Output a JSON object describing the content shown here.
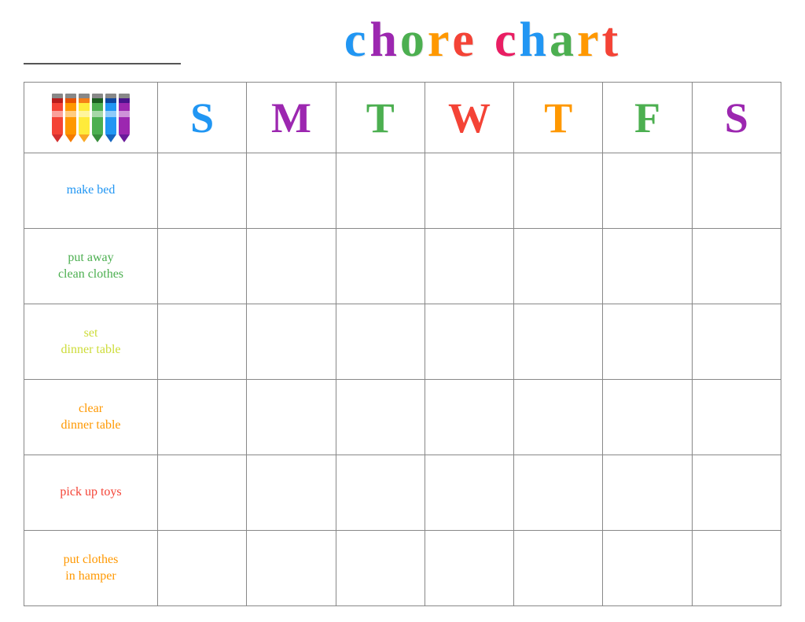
{
  "header": {
    "title_word1": "chore",
    "title_word2": "chart",
    "name_placeholder": ""
  },
  "title_letters": {
    "word1": [
      {
        "char": "c",
        "color": "#2196F3"
      },
      {
        "char": "h",
        "color": "#9C27B0"
      },
      {
        "char": "o",
        "color": "#4CAF50"
      },
      {
        "char": "r",
        "color": "#FF9800"
      },
      {
        "char": "e",
        "color": "#F44336"
      }
    ],
    "word2": [
      {
        "char": "c",
        "color": "#E91E63"
      },
      {
        "char": "h",
        "color": "#2196F3"
      },
      {
        "char": "a",
        "color": "#4CAF50"
      },
      {
        "char": "r",
        "color": "#FF9800"
      },
      {
        "char": "t",
        "color": "#F44336"
      }
    ]
  },
  "days": [
    {
      "label": "S",
      "color": "#2196F3"
    },
    {
      "label": "M",
      "color": "#9C27B0"
    },
    {
      "label": "T",
      "color": "#4CAF50"
    },
    {
      "label": "W",
      "color": "#F44336"
    },
    {
      "label": "T",
      "color": "#FF9800"
    },
    {
      "label": "F",
      "color": "#4CAF50"
    },
    {
      "label": "S",
      "color": "#9C27B0"
    }
  ],
  "chores": [
    {
      "text": "make bed",
      "color": "#2196F3"
    },
    {
      "text": "put away\nclean clothes",
      "color": "#4CAF50"
    },
    {
      "text": "set\ndinner table",
      "color": "#CDDC39"
    },
    {
      "text": "clear\ndinner table",
      "color": "#FF9800"
    },
    {
      "text": "pick up toys",
      "color": "#F44336"
    },
    {
      "text": "put clothes\nin hamper",
      "color": "#FF9800"
    }
  ],
  "crayons": [
    {
      "body": "#F44336",
      "tip": "#D32F2F"
    },
    {
      "body": "#FF9800",
      "tip": "#F57C00"
    },
    {
      "body": "#FFEB3B",
      "tip": "#F9A825"
    },
    {
      "body": "#4CAF50",
      "tip": "#388E3C"
    },
    {
      "body": "#2196F3",
      "tip": "#1565C0"
    },
    {
      "body": "#9C27B0",
      "tip": "#6A1B9A"
    }
  ]
}
